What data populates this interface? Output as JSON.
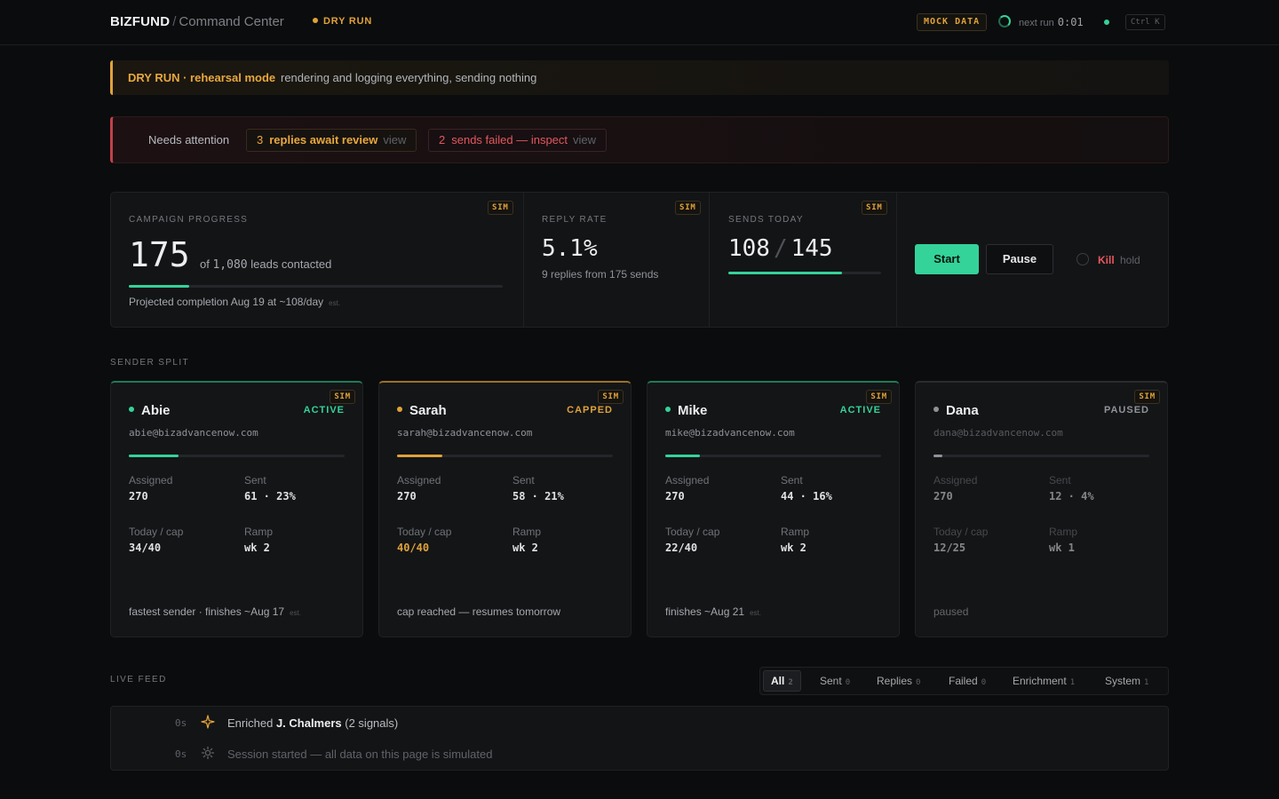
{
  "header": {
    "brand": "BIZFUND",
    "separator": "/",
    "title": "Command Center",
    "mode_tag": "DRY RUN",
    "mock_badge": "MOCK DATA",
    "next_run_label": "next run",
    "next_run_value": "0:01",
    "shortcut": "Ctrl K"
  },
  "dry_run_banner": {
    "title": "DRY RUN · rehearsal mode",
    "text": "rendering and logging everything, sending nothing"
  },
  "attention": {
    "label": "Needs attention",
    "items": [
      {
        "count": "3",
        "text": "replies await review",
        "action": "view"
      },
      {
        "count": "2",
        "text": "sends failed — inspect",
        "action": "view"
      }
    ]
  },
  "stats": {
    "sim_badge": "SIM",
    "progress": {
      "label": "CAMPAIGN PROGRESS",
      "value": "175",
      "of_prefix": "of",
      "total": "1,080",
      "of_suffix": "leads contacted",
      "fraction": 0.162,
      "projection": "Projected completion Aug 19 at ~108/day",
      "est": "est."
    },
    "reply_rate": {
      "label": "REPLY RATE",
      "value": "5.1%",
      "sub": "9 replies from 175 sends"
    },
    "sends_today": {
      "label": "SENDS TODAY",
      "value": "108",
      "sep": "/",
      "cap": "145",
      "fraction": 0.745
    },
    "controls": {
      "start": "Start",
      "pause": "Pause",
      "kill": "Kill",
      "hold": "hold"
    }
  },
  "sender_split": {
    "label": "SENDER SPLIT",
    "assigned_label": "Assigned",
    "sent_label": "Sent",
    "today_label": "Today / cap",
    "ramp_label": "Ramp",
    "senders": [
      {
        "name": "Abie",
        "status": "ACTIVE",
        "email": "abie@bizadvancenow.com",
        "progress": 0.23,
        "assigned": "270",
        "sent": "61 · 23%",
        "today": "34/40",
        "ramp": "wk 2",
        "footer": "fastest sender · finishes ~Aug 17",
        "est": "est.",
        "color": "#34d399"
      },
      {
        "name": "Sarah",
        "status": "CAPPED",
        "email": "sarah@bizadvancenow.com",
        "progress": 0.21,
        "assigned": "270",
        "sent": "58 · 21%",
        "today": "40/40",
        "ramp": "wk 2",
        "footer": "cap reached — resumes tomorrow",
        "est": "",
        "color": "#e0a23a"
      },
      {
        "name": "Mike",
        "status": "ACTIVE",
        "email": "mike@bizadvancenow.com",
        "progress": 0.16,
        "assigned": "270",
        "sent": "44 · 16%",
        "today": "22/40",
        "ramp": "wk 2",
        "footer": "finishes ~Aug 21",
        "est": "est.",
        "color": "#34d399"
      },
      {
        "name": "Dana",
        "status": "PAUSED",
        "email": "dana@bizadvancenow.com",
        "progress": 0.04,
        "assigned": "270",
        "sent": "12 · 4%",
        "today": "12/25",
        "ramp": "wk 1",
        "footer": "paused",
        "est": "",
        "color": "#8f9398"
      }
    ]
  },
  "live_feed": {
    "label": "LIVE FEED",
    "filters": [
      {
        "label": "All",
        "count": "2"
      },
      {
        "label": "Sent",
        "count": "0"
      },
      {
        "label": "Replies",
        "count": "0"
      },
      {
        "label": "Failed",
        "count": "0"
      },
      {
        "label": "Enrichment",
        "count": "1"
      },
      {
        "label": "System",
        "count": "1"
      }
    ],
    "rows": [
      {
        "time": "0s",
        "icon": "sparkle-icon",
        "prefix": "Enriched",
        "name": "J. Chalmers",
        "suffix": "(2 signals)"
      },
      {
        "time": "0s",
        "icon": "gear-icon",
        "text": "Session started — all data on this page is simulated"
      }
    ]
  }
}
